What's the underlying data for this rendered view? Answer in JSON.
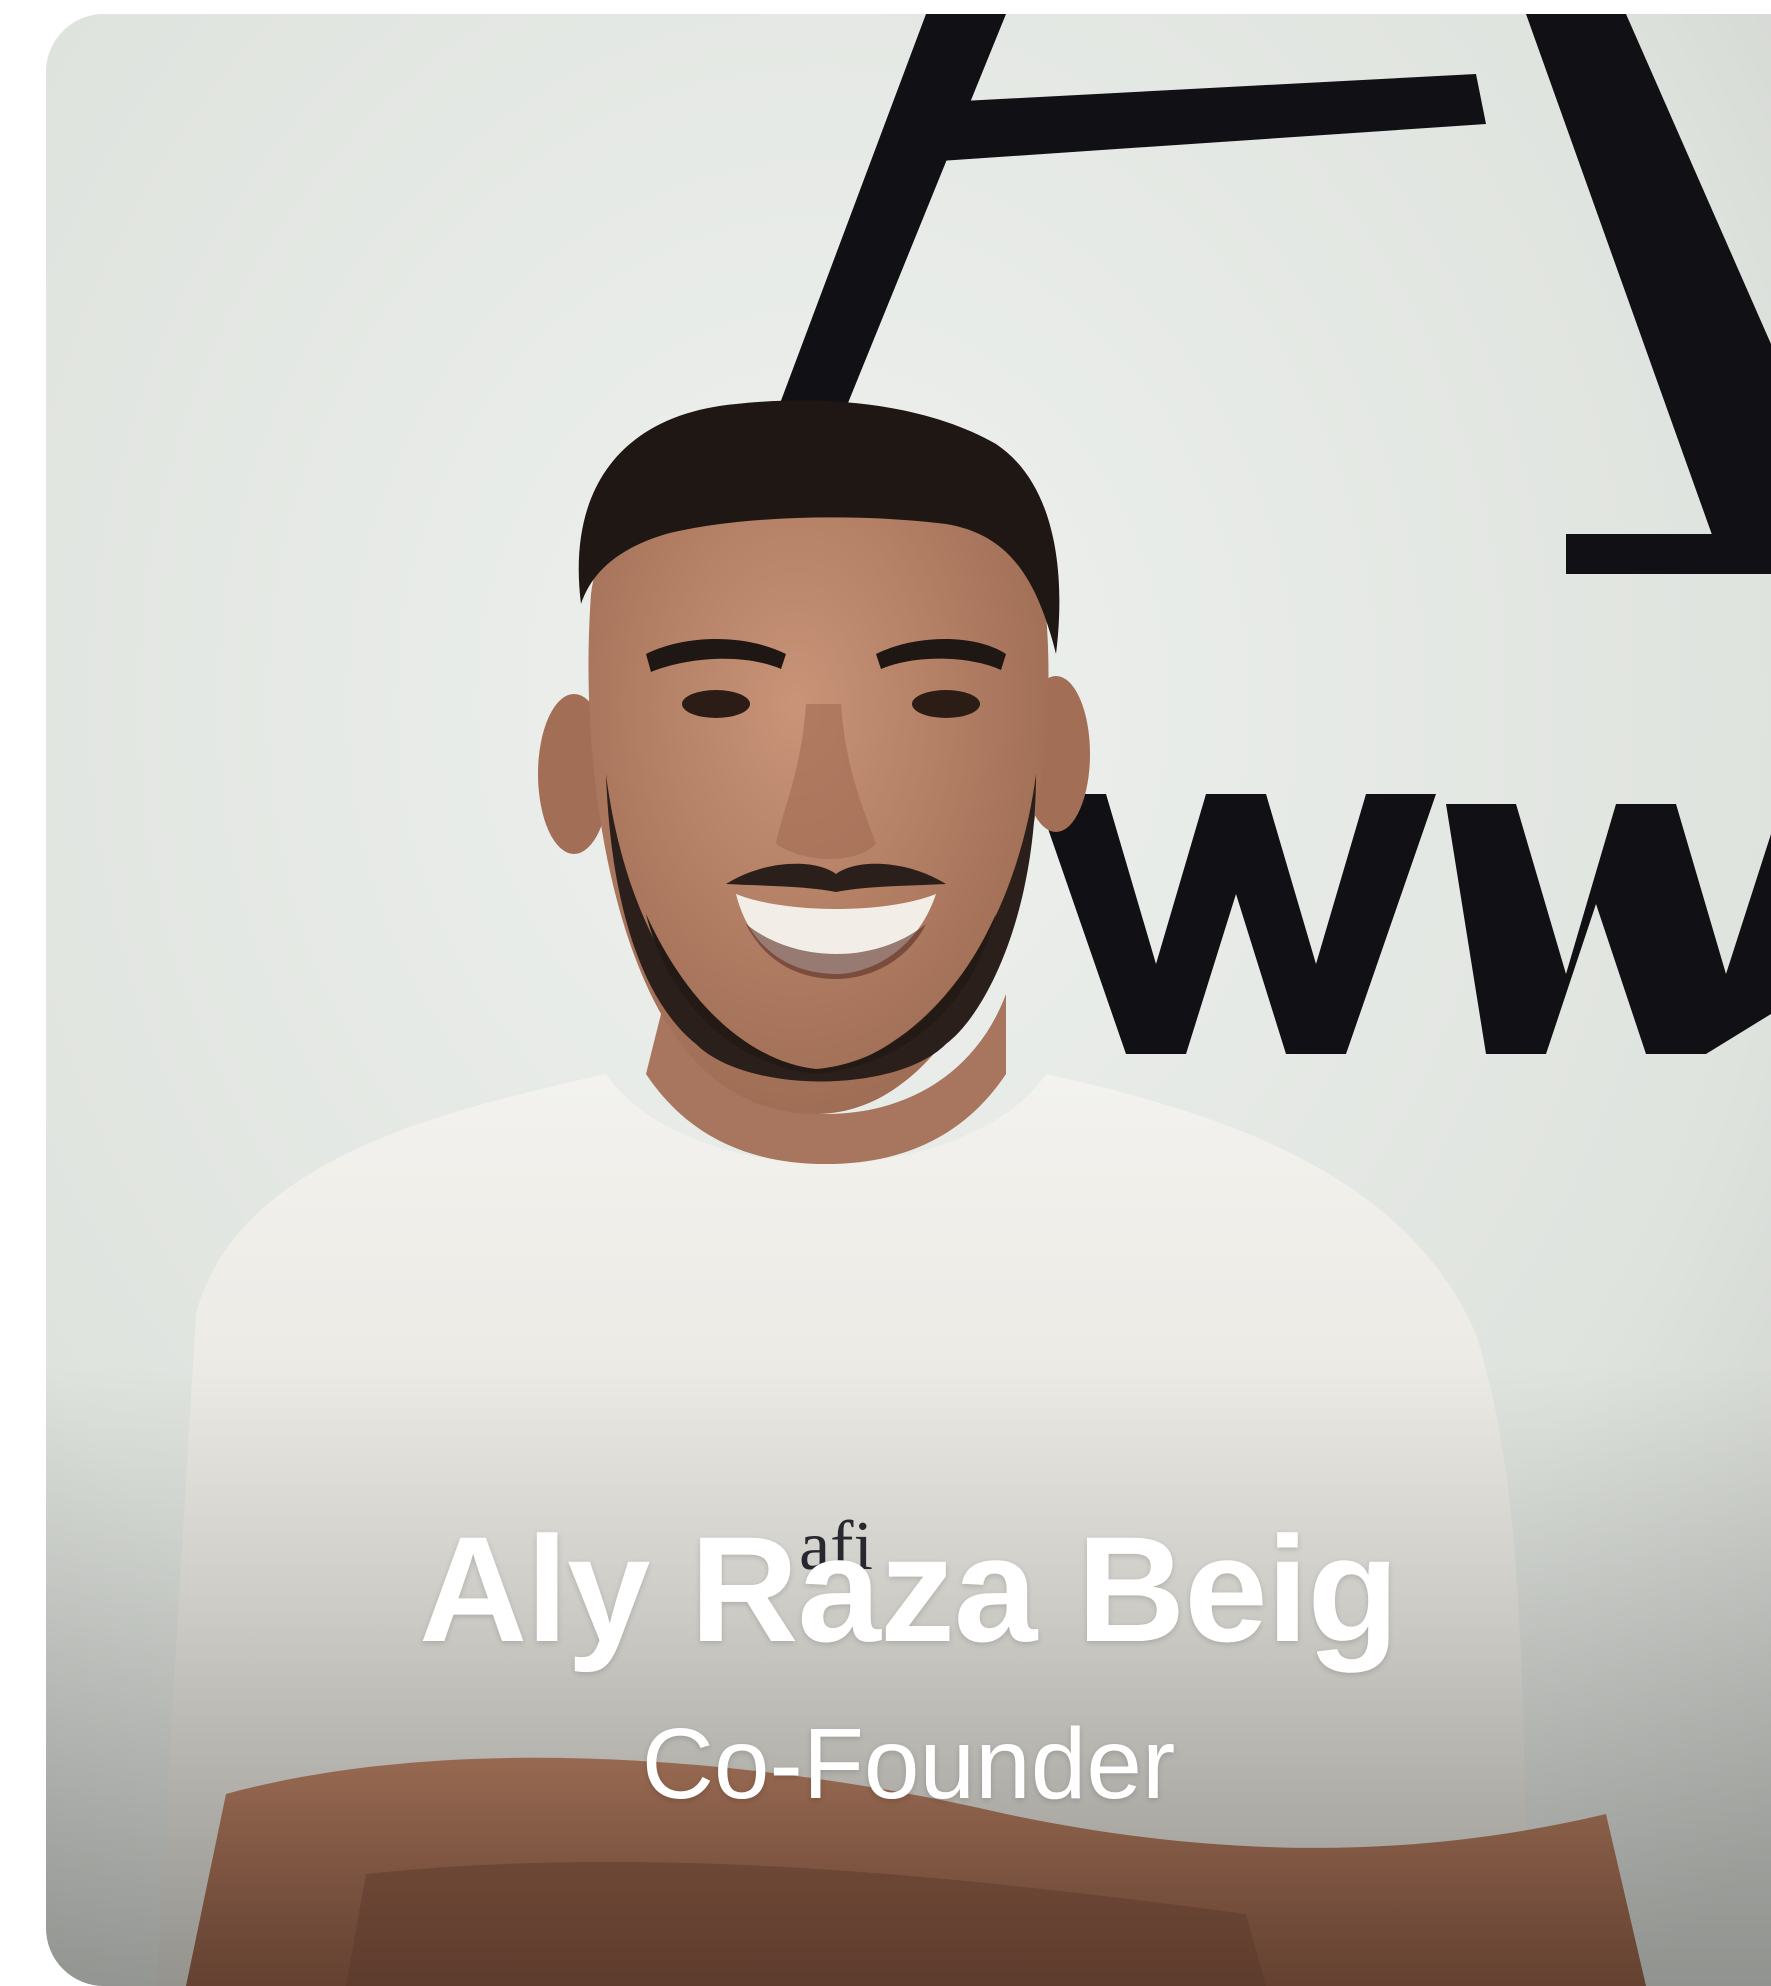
{
  "profile_card": {
    "name": "Aly Raza Beig",
    "role": "Co-Founder"
  },
  "photo": {
    "subject": "smiling man with short dark hair and beard, arms crossed, wearing a white t-shirt",
    "background_lettering": "A www",
    "shirt_print": "afi"
  },
  "colors": {
    "wall": "#e2e6e2",
    "lettering": "#101014",
    "shirt": "#ecebe6",
    "skin": "#b98468",
    "hair": "#1e1713",
    "caption_text": "#ffffff"
  }
}
